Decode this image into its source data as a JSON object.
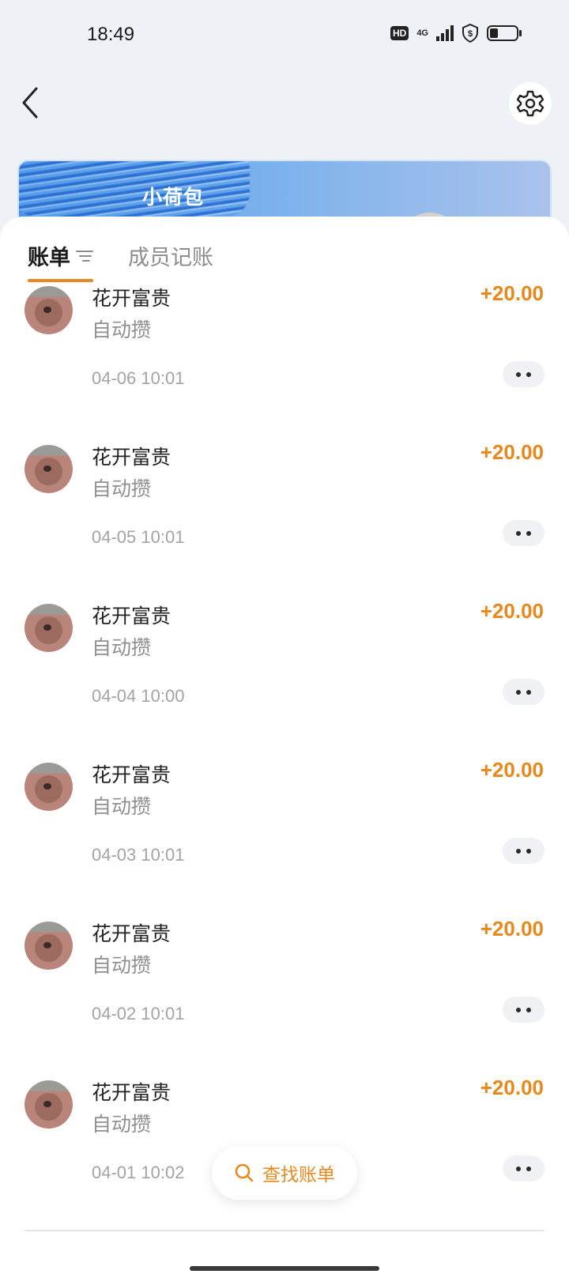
{
  "status_bar": {
    "time": "18:49",
    "hd": "HD",
    "network": "4G"
  },
  "banner": {
    "title": "小荷包"
  },
  "tabs": {
    "bills": "账单",
    "members": "成员记账"
  },
  "transactions": [
    {
      "name": "花开富贵",
      "desc": "自动攒",
      "amount": "+20.00",
      "date": "04-06 10:01"
    },
    {
      "name": "花开富贵",
      "desc": "自动攒",
      "amount": "+20.00",
      "date": "04-05 10:01"
    },
    {
      "name": "花开富贵",
      "desc": "自动攒",
      "amount": "+20.00",
      "date": "04-04 10:00"
    },
    {
      "name": "花开富贵",
      "desc": "自动攒",
      "amount": "+20.00",
      "date": "04-03 10:01"
    },
    {
      "name": "花开富贵",
      "desc": "自动攒",
      "amount": "+20.00",
      "date": "04-02 10:01"
    },
    {
      "name": "花开富贵",
      "desc": "自动攒",
      "amount": "+20.00",
      "date": "04-01 10:02"
    }
  ],
  "search_button": {
    "label": "查找账单"
  },
  "colors": {
    "accent": "#e68a1f",
    "background": "#eef1f6"
  }
}
